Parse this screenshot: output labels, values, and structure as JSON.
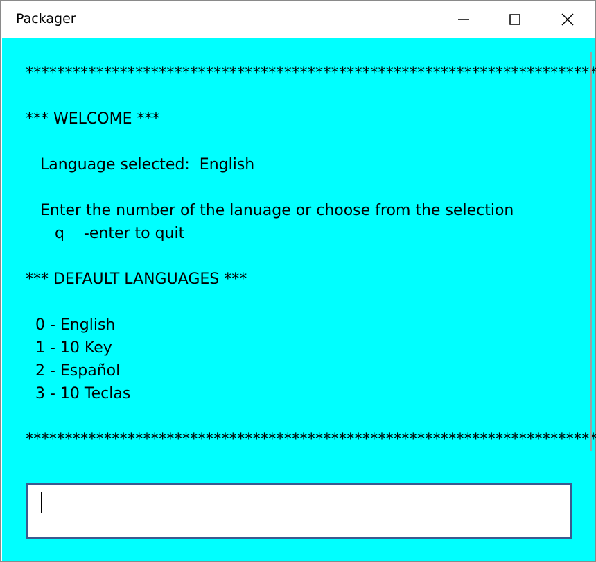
{
  "window": {
    "title": "Packager",
    "controls": {
      "minimize_icon": "minimize-icon",
      "maximize_icon": "maximize-icon",
      "close_icon": "close-icon"
    }
  },
  "colors": {
    "background": "#00ffff",
    "text": "#000000",
    "input_border": "#3c5a8f",
    "input_background": "#ffffff"
  },
  "console": {
    "lines": [
      "*************************************************************************",
      "",
      "*** WELCOME ***",
      "",
      "   Language selected:  English",
      "",
      "   Enter the number of the lanuage or choose from the selection",
      "      q    -enter to quit",
      "",
      "*** DEFAULT LANGUAGES ***",
      "",
      "  0 - English",
      "  1 - 10 Key",
      "  2 - Español",
      "  3 - 10 Teclas",
      "",
      "*************************************************************************"
    ]
  },
  "input": {
    "value": ""
  }
}
